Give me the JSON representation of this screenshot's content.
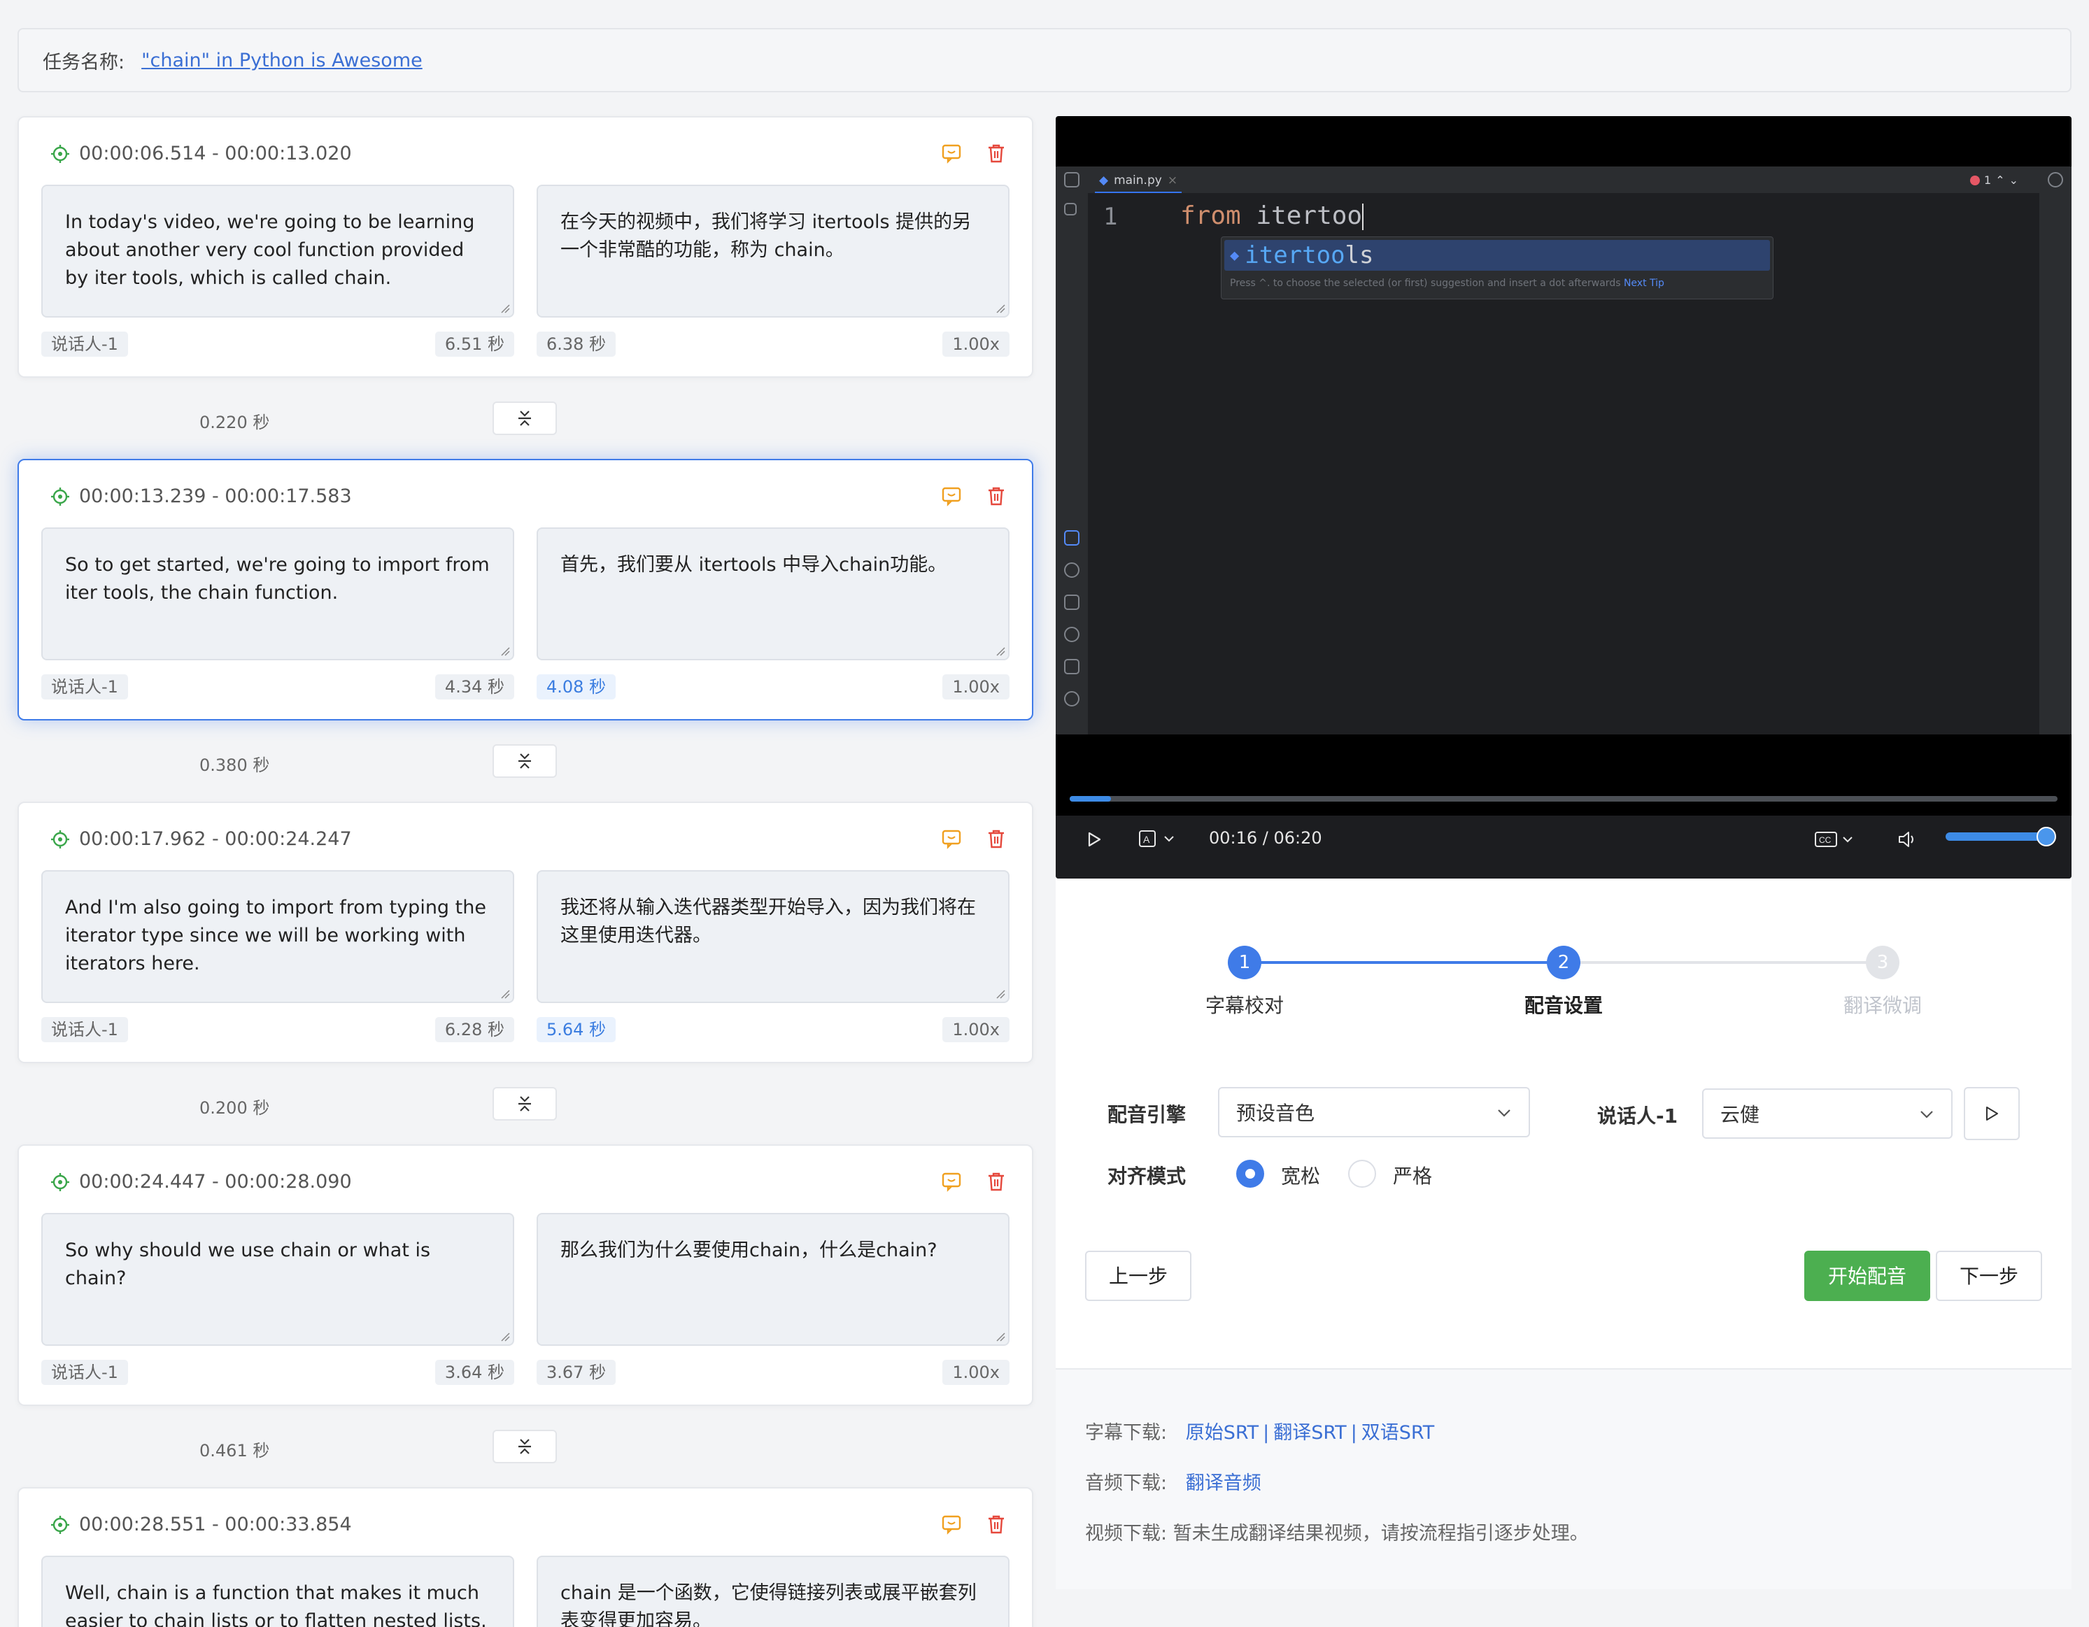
{
  "task": {
    "label": "任务名称:",
    "name": "\"chain\" in Python is Awesome"
  },
  "segments": [
    {
      "time": "00:00:06.514 - 00:00:13.020",
      "src": "In today's video, we're going to be learning about another very cool function provided by iter tools, which is called chain.",
      "dst": "在今天的视频中，我们将学习 itertools 提供的另一个非常酷的功能，称为 chain。",
      "speaker": "说话人-1",
      "src_dur": "6.51 秒",
      "dst_dur": "6.38 秒",
      "speed": "1.00x"
    },
    {
      "time": "00:00:13.239 - 00:00:17.583",
      "src": "So to get started, we're going to import from iter tools,  the chain function.",
      "dst": "首先，我们要从 itertools 中导入chain功能。",
      "speaker": "说话人-1",
      "src_dur": "4.34 秒",
      "dst_dur": "4.08 秒",
      "speed": "1.00x"
    },
    {
      "time": "00:00:17.962 - 00:00:24.247",
      "src": "And I'm also going to import from typing the iterator type since we will be working with iterators here.",
      "dst": "我还将从输入迭代器类型开始导入，因为我们将在这里使用迭代器。",
      "speaker": "说话人-1",
      "src_dur": "6.28 秒",
      "dst_dur": "5.64 秒",
      "speed": "1.00x"
    },
    {
      "time": "00:00:24.447 - 00:00:28.090",
      "src": "So why should we use chain or what is chain?",
      "dst": "那么我们为什么要使用chain，什么是chain?",
      "speaker": "说话人-1",
      "src_dur": "3.64 秒",
      "dst_dur": "3.67 秒",
      "speed": "1.00x"
    },
    {
      "time": "00:00:28.551 - 00:00:33.854",
      "src": "Well, chain is a function that makes it much easier to chain lists or to flatten nested lists.",
      "dst": "chain 是一个函数，它使得链接列表或展平嵌套列表变得更加容易。",
      "speaker": "",
      "src_dur": "",
      "dst_dur": "",
      "speed": ""
    }
  ],
  "gaps": [
    "0.220 秒",
    "0.380 秒",
    "0.200 秒",
    "0.461 秒"
  ],
  "video": {
    "tab": "main.py",
    "line_no": "1",
    "code_kw": "from",
    "code_rest": " itertoo",
    "suggest_match": "itertoo",
    "suggest_rest": "ls",
    "hint": "Press ^. to choose the selected (or first) suggestion and insert a dot afterwards",
    "hint_link": "Next Tip",
    "error_count": "1",
    "time": "00:16 / 06:20",
    "progress": 0.042,
    "volume": 1.0
  },
  "steps": [
    {
      "num": "1",
      "label": "字幕校对",
      "state": "done"
    },
    {
      "num": "2",
      "label": "配音设置",
      "state": "active"
    },
    {
      "num": "3",
      "label": "翻译微调",
      "state": "pending"
    }
  ],
  "form": {
    "engine_label": "配音引擎",
    "engine_value": "预设音色",
    "speaker_label": "说话人-1",
    "speaker_value": "云健",
    "align_label": "对齐模式",
    "align_loose": "宽松",
    "align_strict": "严格"
  },
  "buttons": {
    "prev": "上一步",
    "start": "开始配音",
    "next": "下一步"
  },
  "downloads": {
    "subtitle_label": "字幕下载:",
    "subtitle_links": [
      "原始SRT",
      "翻译SRT",
      "双语SRT"
    ],
    "audio_label": "音频下载:",
    "audio_link": "翻译音频",
    "video_label": "视频下载:",
    "video_text": "暂未生成翻译结果视频，请按流程指引逐步处理。"
  },
  "colors": {
    "accent": "#3f7be8",
    "success": "#4caf50",
    "warning": "#f0a020",
    "danger": "#e5483c",
    "locate": "#3aa64a"
  }
}
